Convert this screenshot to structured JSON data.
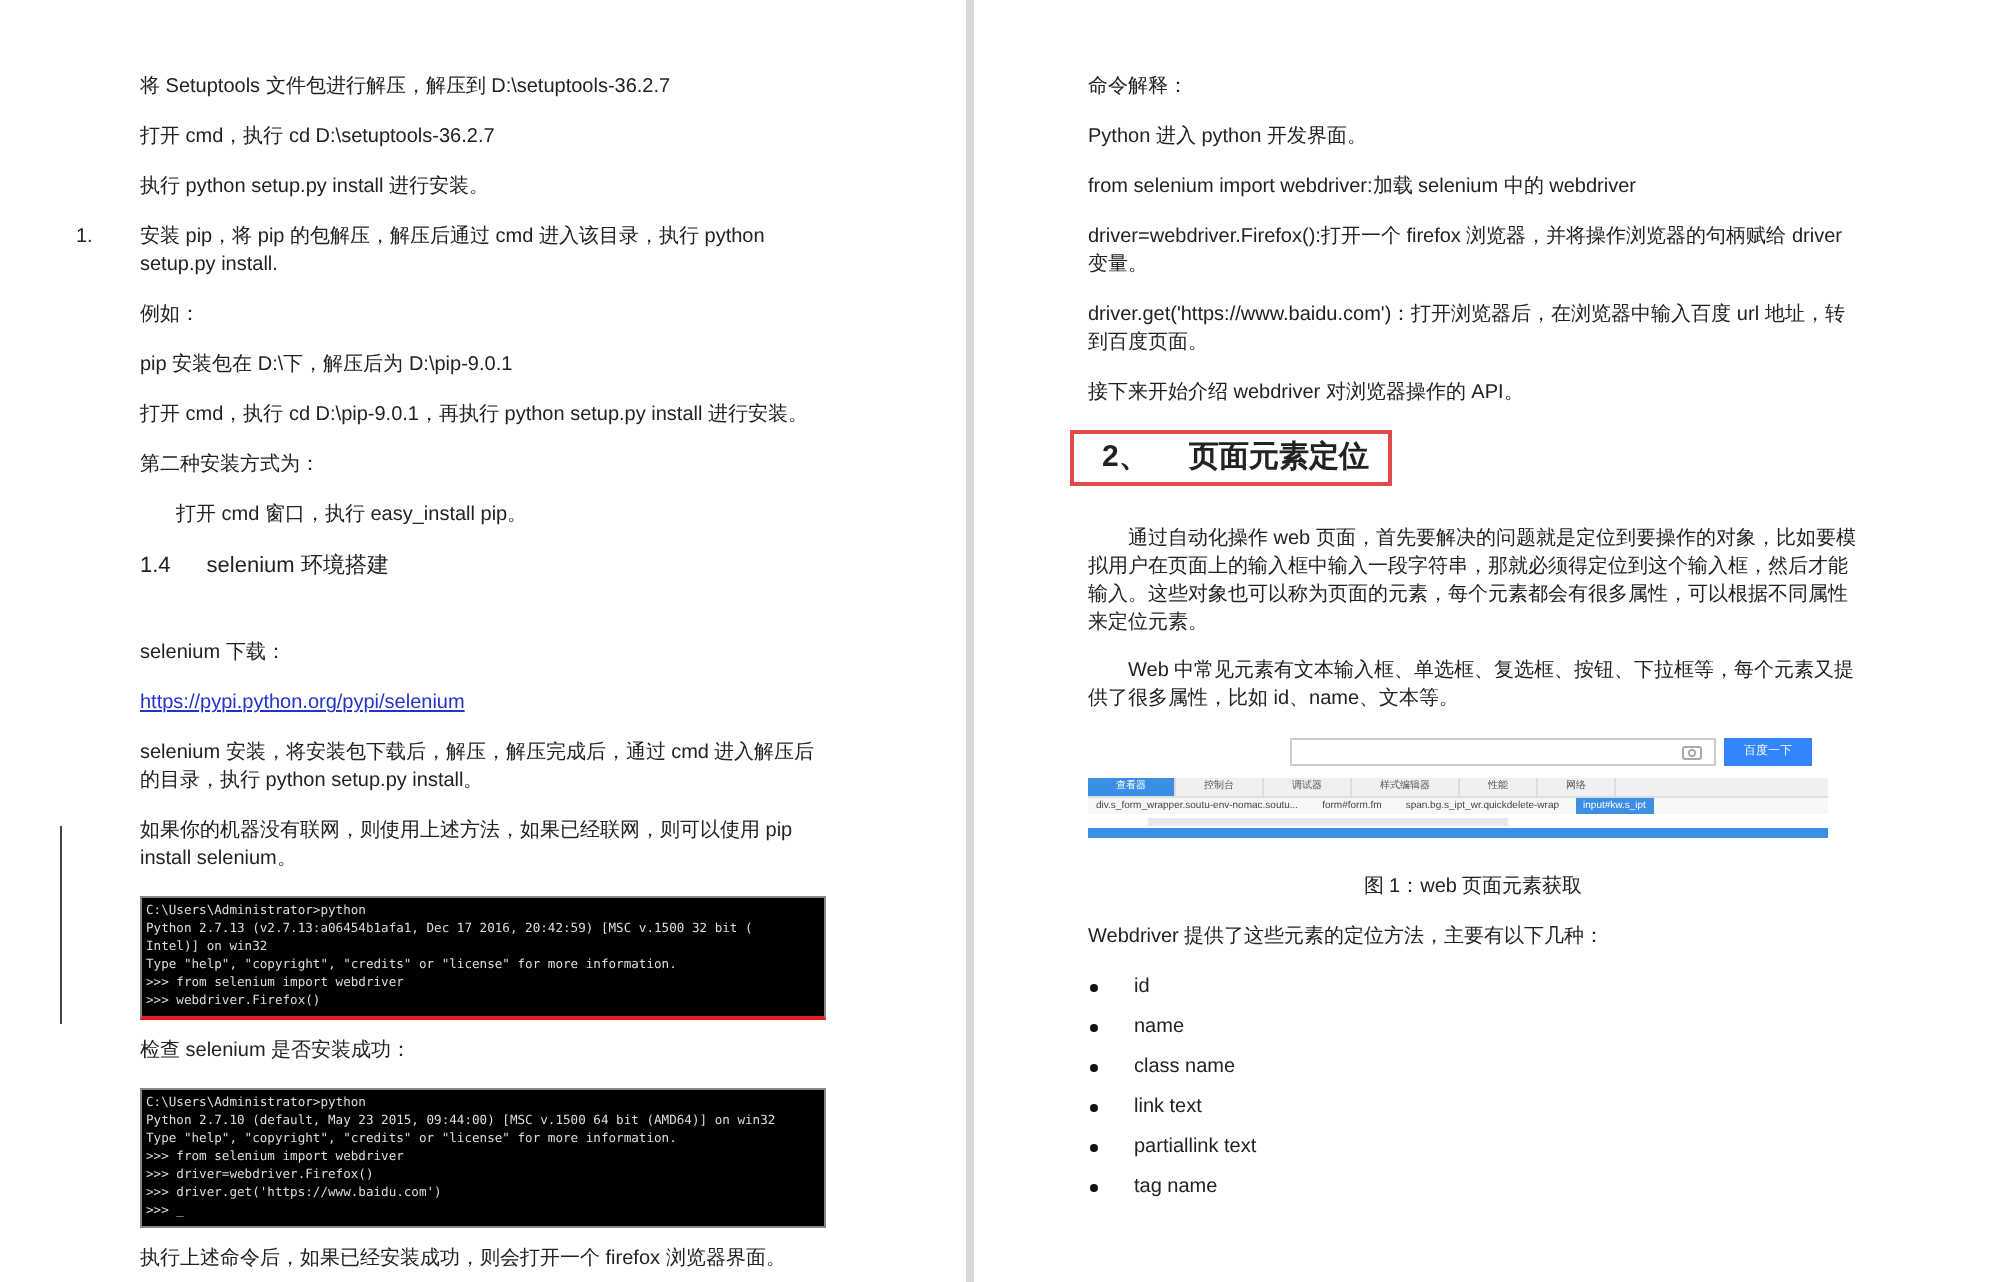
{
  "left_page": {
    "blocks": [
      {
        "kind": "para",
        "text": "将 Setuptools 文件包进行解压，解压到 D:\\setuptools-36.2.7"
      },
      {
        "kind": "para",
        "text": "打开 cmd，执行 cd D:\\setuptools-36.2.7"
      },
      {
        "kind": "para",
        "text": "执行 python setup.py install 进行安装。"
      },
      {
        "kind": "numbered",
        "number": "1.",
        "text": "安装 pip，将 pip 的包解压，解压后通过 cmd 进入该目录，执行 python setup.py install."
      },
      {
        "kind": "para",
        "text": "例如："
      },
      {
        "kind": "para",
        "text": "pip 安装包在 D:\\下，解压后为 D:\\pip-9.0.1"
      },
      {
        "kind": "para",
        "text": "打开 cmd，执行 cd D:\\pip-9.0.1，再执行 python setup.py install 进行安装。"
      },
      {
        "kind": "para",
        "text": "第二种安装方式为："
      },
      {
        "kind": "indented",
        "text": "打开 cmd 窗口，执行 easy_install pip。"
      },
      {
        "kind": "subheading",
        "number": "1.4",
        "text": "selenium 环境搭建"
      },
      {
        "kind": "para",
        "text": "selenium 下载："
      },
      {
        "kind": "link",
        "text": "https://pypi.python.org/pypi/selenium"
      },
      {
        "kind": "para",
        "text": "selenium 安装，将安装包下载后，解压，解压完成后，通过 cmd 进入解压后的目录，执行 python setup.py install。"
      },
      {
        "kind": "para",
        "changed": true,
        "text": "如果你的机器没有联网，则使用上述方法，如果已经联网，则可以使用 pip install selenium。"
      },
      {
        "kind": "terminal",
        "underlined": true,
        "changed": true,
        "lines": [
          "C:\\Users\\Administrator>python",
          "Python 2.7.13 (v2.7.13:a06454b1afa1, Dec 17 2016, 20:42:59) [MSC v.1500 32 bit (",
          "Intel)] on win32",
          "Type \"help\", \"copyright\", \"credits\" or \"license\" for more information.",
          ">>> from selenium import webdriver",
          ">>> webdriver.Firefox()"
        ]
      },
      {
        "kind": "para",
        "text": "检查 selenium 是否安装成功："
      },
      {
        "kind": "terminal",
        "underlined": false,
        "lines": [
          "C:\\Users\\Administrator>python",
          "Python 2.7.10 (default, May 23 2015, 09:44:00) [MSC v.1500 64 bit (AMD64)] on win32",
          "Type \"help\", \"copyright\", \"credits\" or \"license\" for more information.",
          ">>> from selenium import webdriver",
          ">>> driver=webdriver.Firefox()",
          ">>> driver.get('https://www.baidu.com')",
          ">>> _"
        ]
      },
      {
        "kind": "para",
        "text": "执行上述命令后，如果已经安装成功，则会打开一个 firefox 浏览器界面。"
      }
    ]
  },
  "right_page": {
    "blocks": [
      {
        "kind": "para",
        "text": "命令解释："
      },
      {
        "kind": "para",
        "text": "Python 进入 python 开发界面。"
      },
      {
        "kind": "para",
        "text": "from selenium import webdriver:加载 selenium 中的 webdriver"
      },
      {
        "kind": "para",
        "text": "driver=webdriver.Firefox():打开一个 firefox 浏览器，并将操作浏览器的句柄赋给 driver 变量。"
      },
      {
        "kind": "para",
        "text": "driver.get('https://www.baidu.com')：打开浏览器后，在浏览器中输入百度 url 地址，转到百度页面。"
      },
      {
        "kind": "para",
        "text": "接下来开始介绍 webdriver 对浏览器操作的 API。"
      },
      {
        "kind": "heading",
        "boxed": true,
        "number": "2、",
        "text": "页面元素定位"
      },
      {
        "kind": "body",
        "text": "通过自动化操作 web 页面，首先要解决的问题就是定位到要操作的对象，比如要模拟用户在页面上的输入框中输入一段字符串，那就必须得定位到这个输入框，然后才能输入。这些对象也可以称为页面的元素，每个元素都会有很多属性，可以根据不同属性来定位元素。"
      },
      {
        "kind": "body",
        "text": "Web 中常见元素有文本输入框、单选框、复选框、按钮、下拉框等，每个元素又提供了很多属性，比如 id、name、文本等。"
      },
      {
        "kind": "figure",
        "button": "百度一下",
        "tabs": [
          "查看器",
          "控制台",
          "调试器",
          "样式编辑器",
          "性能",
          "网络"
        ],
        "crumbs": [
          "div.s_form_wrapper.soutu-env-nomac.soutu...",
          "form#form.fm",
          "span.bg.s_ipt_wr.quickdelete-wrap",
          "input#kw.s_ipt"
        ]
      },
      {
        "kind": "caption",
        "text": "图 1：web 页面元素获取"
      },
      {
        "kind": "para",
        "text": "Webdriver 提供了这些元素的定位方法，主要有以下几种："
      },
      {
        "kind": "bullet",
        "text": "id"
      },
      {
        "kind": "bullet",
        "text": "name"
      },
      {
        "kind": "bullet",
        "text": "class name"
      },
      {
        "kind": "bullet",
        "text": "link text"
      },
      {
        "kind": "bullet",
        "text": "partiallink text"
      },
      {
        "kind": "bullet",
        "text": "tag name"
      }
    ]
  }
}
